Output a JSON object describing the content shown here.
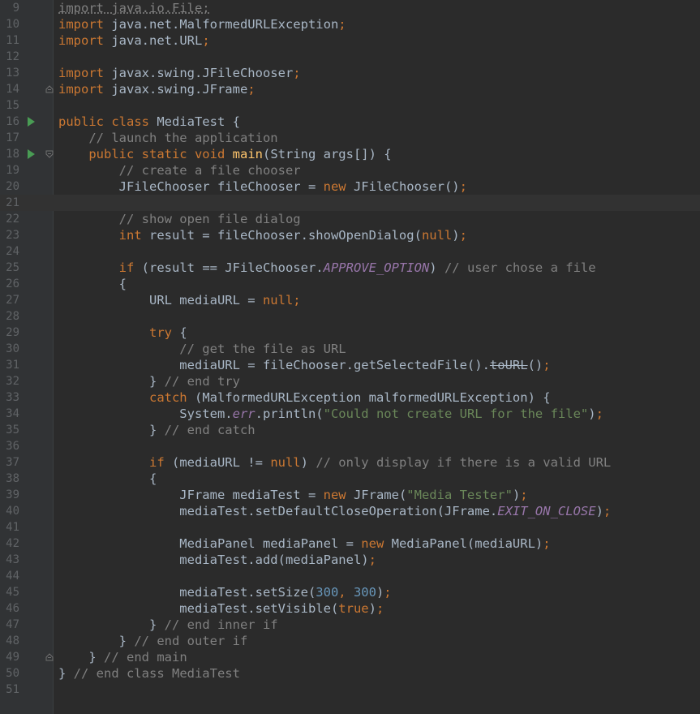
{
  "colors": {
    "background": "#2b2b2b",
    "gutter": "#313335",
    "line_number": "#606366",
    "text": "#a9b7c6",
    "keyword": "#cc7832",
    "method_decl": "#ffc66d",
    "comment": "#808080",
    "string": "#6a8759",
    "number": "#6897bb",
    "constant": "#9876aa",
    "run_icon": "#499c54"
  },
  "lines": [
    {
      "n": "9",
      "segments": [
        {
          "t": "import java.io.File;",
          "c": "unused"
        }
      ]
    },
    {
      "n": "10",
      "segments": [
        {
          "t": "import",
          "c": "kw"
        },
        {
          "t": " java.net.MalformedURLException"
        },
        {
          "t": ";",
          "c": "kw"
        }
      ]
    },
    {
      "n": "11",
      "segments": [
        {
          "t": "import",
          "c": "kw"
        },
        {
          "t": " java.net.URL"
        },
        {
          "t": ";",
          "c": "kw"
        }
      ]
    },
    {
      "n": "12",
      "segments": []
    },
    {
      "n": "13",
      "segments": [
        {
          "t": "import",
          "c": "kw"
        },
        {
          "t": " javax.swing.JFileChooser"
        },
        {
          "t": ";",
          "c": "kw"
        }
      ]
    },
    {
      "n": "14",
      "fold": "end",
      "segments": [
        {
          "t": "import",
          "c": "kw"
        },
        {
          "t": " javax.swing.JFrame"
        },
        {
          "t": ";",
          "c": "kw"
        }
      ]
    },
    {
      "n": "15",
      "segments": []
    },
    {
      "n": "16",
      "run": true,
      "segments": [
        {
          "t": "public class",
          "c": "kw"
        },
        {
          "t": " MediaTest {"
        }
      ]
    },
    {
      "n": "17",
      "segments": [
        {
          "t": "    // launch the application",
          "c": "cm"
        }
      ]
    },
    {
      "n": "18",
      "run": true,
      "fold": "start",
      "segments": [
        {
          "t": "    "
        },
        {
          "t": "public static void",
          "c": "kw"
        },
        {
          "t": " "
        },
        {
          "t": "main",
          "c": "fn"
        },
        {
          "t": "(String args[]) {"
        }
      ]
    },
    {
      "n": "19",
      "segments": [
        {
          "t": "        // create a file chooser",
          "c": "cm"
        }
      ]
    },
    {
      "n": "20",
      "segments": [
        {
          "t": "        JFileChooser fileChooser = "
        },
        {
          "t": "new",
          "c": "kw"
        },
        {
          "t": " JFileChooser()"
        },
        {
          "t": ";",
          "c": "kw"
        }
      ]
    },
    {
      "n": "21",
      "current": true,
      "segments": []
    },
    {
      "n": "22",
      "segments": [
        {
          "t": "        // show open file dialog",
          "c": "cm"
        }
      ]
    },
    {
      "n": "23",
      "segments": [
        {
          "t": "        "
        },
        {
          "t": "int",
          "c": "kw"
        },
        {
          "t": " result = fileChooser.showOpenDialog("
        },
        {
          "t": "null",
          "c": "kw"
        },
        {
          "t": ")"
        },
        {
          "t": ";",
          "c": "kw"
        }
      ]
    },
    {
      "n": "24",
      "segments": []
    },
    {
      "n": "25",
      "segments": [
        {
          "t": "        "
        },
        {
          "t": "if",
          "c": "kw"
        },
        {
          "t": " (result == JFileChooser."
        },
        {
          "t": "APPROVE_OPTION",
          "c": "const"
        },
        {
          "t": ") "
        },
        {
          "t": "// user chose a file",
          "c": "cm"
        }
      ]
    },
    {
      "n": "26",
      "segments": [
        {
          "t": "        {"
        }
      ]
    },
    {
      "n": "27",
      "segments": [
        {
          "t": "            URL mediaURL = "
        },
        {
          "t": "null",
          "c": "kw"
        },
        {
          "t": ";",
          "c": "kw"
        }
      ]
    },
    {
      "n": "28",
      "segments": []
    },
    {
      "n": "29",
      "segments": [
        {
          "t": "            "
        },
        {
          "t": "try",
          "c": "kw"
        },
        {
          "t": " {"
        }
      ]
    },
    {
      "n": "30",
      "segments": [
        {
          "t": "                // get the file as URL",
          "c": "cm"
        }
      ]
    },
    {
      "n": "31",
      "segments": [
        {
          "t": "                mediaURL = fileChooser.getSelectedFile()."
        },
        {
          "t": "toURL",
          "c": "deprecated"
        },
        {
          "t": "()"
        },
        {
          "t": ";",
          "c": "kw"
        }
      ]
    },
    {
      "n": "32",
      "segments": [
        {
          "t": "            } "
        },
        {
          "t": "// end try",
          "c": "cm"
        }
      ]
    },
    {
      "n": "33",
      "segments": [
        {
          "t": "            "
        },
        {
          "t": "catch",
          "c": "kw"
        },
        {
          "t": " (MalformedURLException malformedURLException) {"
        }
      ]
    },
    {
      "n": "34",
      "segments": [
        {
          "t": "                System."
        },
        {
          "t": "err",
          "c": "field"
        },
        {
          "t": ".println("
        },
        {
          "t": "\"Could not create URL for the file\"",
          "c": "str"
        },
        {
          "t": ")"
        },
        {
          "t": ";",
          "c": "kw"
        }
      ]
    },
    {
      "n": "35",
      "segments": [
        {
          "t": "            } "
        },
        {
          "t": "// end catch",
          "c": "cm"
        }
      ]
    },
    {
      "n": "36",
      "segments": []
    },
    {
      "n": "37",
      "segments": [
        {
          "t": "            "
        },
        {
          "t": "if",
          "c": "kw"
        },
        {
          "t": " (mediaURL != "
        },
        {
          "t": "null",
          "c": "kw"
        },
        {
          "t": ") "
        },
        {
          "t": "// only display if there is a valid URL",
          "c": "cm"
        }
      ]
    },
    {
      "n": "38",
      "segments": [
        {
          "t": "            {"
        }
      ]
    },
    {
      "n": "39",
      "segments": [
        {
          "t": "                JFrame mediaTest = "
        },
        {
          "t": "new",
          "c": "kw"
        },
        {
          "t": " JFrame("
        },
        {
          "t": "\"Media Tester\"",
          "c": "str"
        },
        {
          "t": ")"
        },
        {
          "t": ";",
          "c": "kw"
        }
      ]
    },
    {
      "n": "40",
      "segments": [
        {
          "t": "                mediaTest.setDefaultCloseOperation(JFrame."
        },
        {
          "t": "EXIT_ON_CLOSE",
          "c": "const"
        },
        {
          "t": ")"
        },
        {
          "t": ";",
          "c": "kw"
        }
      ]
    },
    {
      "n": "41",
      "segments": []
    },
    {
      "n": "42",
      "segments": [
        {
          "t": "                MediaPanel mediaPanel = "
        },
        {
          "t": "new",
          "c": "kw"
        },
        {
          "t": " MediaPanel(mediaURL)"
        },
        {
          "t": ";",
          "c": "kw"
        }
      ]
    },
    {
      "n": "43",
      "segments": [
        {
          "t": "                mediaTest.add(mediaPanel)"
        },
        {
          "t": ";",
          "c": "kw"
        }
      ]
    },
    {
      "n": "44",
      "segments": []
    },
    {
      "n": "45",
      "segments": [
        {
          "t": "                mediaTest.setSize("
        },
        {
          "t": "300",
          "c": "num"
        },
        {
          "t": ", ",
          "c": "kw"
        },
        {
          "t": "300",
          "c": "num"
        },
        {
          "t": ")"
        },
        {
          "t": ";",
          "c": "kw"
        }
      ]
    },
    {
      "n": "46",
      "segments": [
        {
          "t": "                mediaTest.setVisible("
        },
        {
          "t": "true",
          "c": "kw"
        },
        {
          "t": ")"
        },
        {
          "t": ";",
          "c": "kw"
        }
      ]
    },
    {
      "n": "47",
      "segments": [
        {
          "t": "            } "
        },
        {
          "t": "// end inner if",
          "c": "cm"
        }
      ]
    },
    {
      "n": "48",
      "segments": [
        {
          "t": "        } "
        },
        {
          "t": "// end outer if",
          "c": "cm"
        }
      ]
    },
    {
      "n": "49",
      "fold": "end",
      "segments": [
        {
          "t": "    } "
        },
        {
          "t": "// end main",
          "c": "cm"
        }
      ]
    },
    {
      "n": "50",
      "segments": [
        {
          "t": "} "
        },
        {
          "t": "// end class MediaTest",
          "c": "cm"
        }
      ]
    },
    {
      "n": "51",
      "segments": []
    }
  ]
}
